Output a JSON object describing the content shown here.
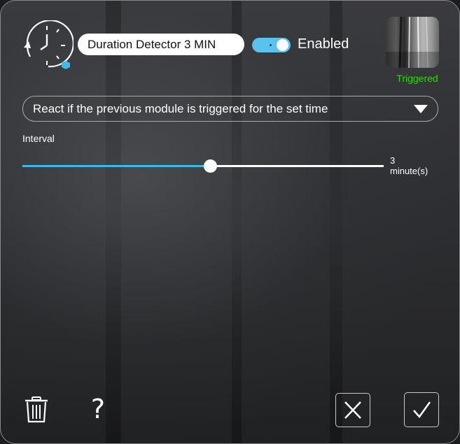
{
  "detector": {
    "icon": "duration-clock-icon",
    "name_value": "Duration Detector 3 MIN",
    "enabled": true,
    "enabled_label": "Enabled"
  },
  "preview": {
    "status": "Triggered",
    "status_color": "#22e000"
  },
  "mode_select": {
    "selected": "React if the previous module is triggered for the set time"
  },
  "interval": {
    "label": "Interval",
    "value": 3,
    "value_text": "3",
    "unit": "minute(s)",
    "fill_fraction": 0.52,
    "accent_color": "#43b7ea"
  },
  "footer": {
    "delete_icon": "trash-icon",
    "help_icon": "question-mark-icon",
    "help_glyph": "?",
    "cancel_icon": "close-icon",
    "confirm_icon": "checkmark-icon"
  },
  "colors": {
    "toggle_on": "#5bc1ee",
    "panel_border": "#8a8b8d"
  }
}
